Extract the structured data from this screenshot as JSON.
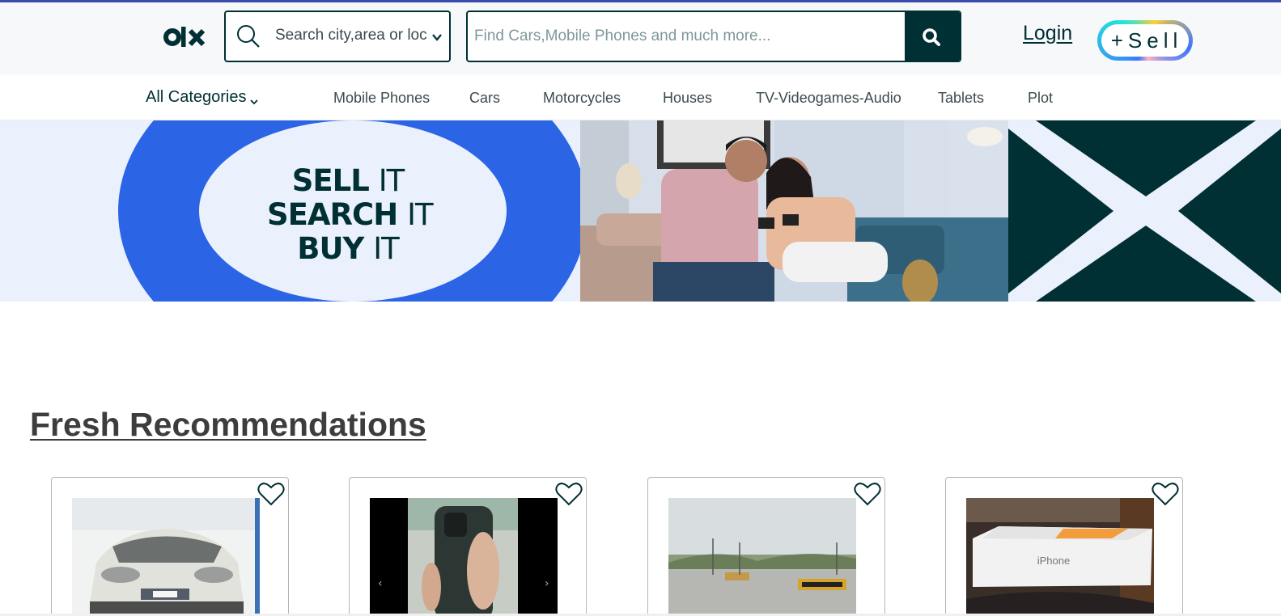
{
  "header": {
    "logo_text": "OLX",
    "location_search": {
      "value": "Search city,area or loc",
      "icon": "search-icon",
      "dropdown_icon": "chevron-down-icon"
    },
    "main_search": {
      "placeholder": "Find Cars,Mobile Phones and much more...",
      "button_icon": "search-icon"
    },
    "login_label": "Login",
    "sell_label": "+Sell"
  },
  "categories": {
    "all_label": "All Categories",
    "items": [
      "Mobile Phones",
      "Cars",
      "Motorcycles",
      "Houses",
      "TV-Videogames-Audio",
      "Tablets",
      "Plot"
    ]
  },
  "banner": {
    "slogan": [
      {
        "bold": "SELL",
        "thin": "IT"
      },
      {
        "bold": "SEARCH",
        "thin": "IT"
      },
      {
        "bold": "BUY",
        "thin": "IT"
      }
    ]
  },
  "section": {
    "title": "Fresh Recommendations",
    "cards": [
      {
        "image": "white car front",
        "favorite_icon": "heart-icon"
      },
      {
        "image": "phone in hand",
        "favorite_icon": "heart-icon"
      },
      {
        "image": "road plot",
        "favorite_icon": "heart-icon"
      },
      {
        "image": "iPhone box",
        "image_text": "iPhone",
        "favorite_icon": "heart-icon"
      }
    ]
  },
  "colors": {
    "brand": "#002f34",
    "accent_blue": "#2c64e6",
    "top_accent": "#3a4bab",
    "header_bg": "#f7f8f9",
    "banner_bg": "#ebf1fc"
  }
}
